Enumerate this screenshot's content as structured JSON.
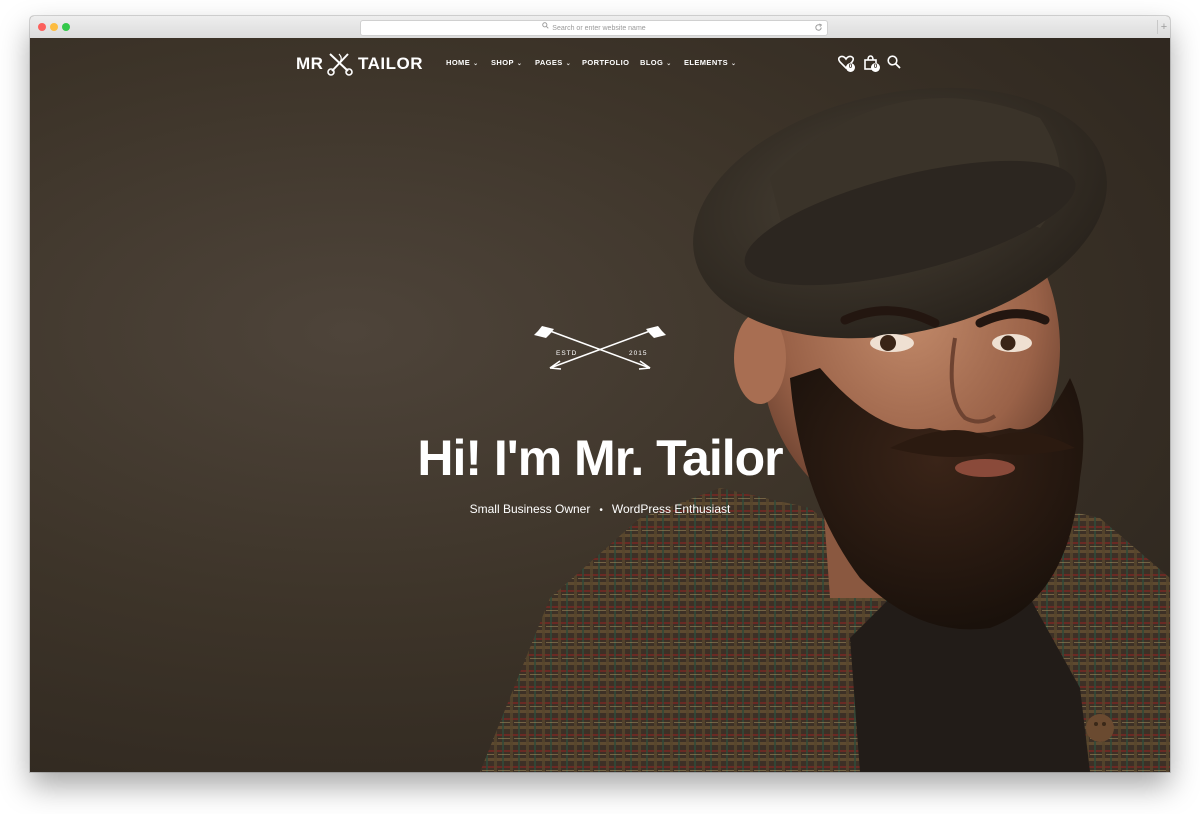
{
  "browser": {
    "url_placeholder": "Search or enter website name",
    "new_tab_symbol": "+"
  },
  "site": {
    "logo_left": "MR",
    "logo_right": "TAILOR"
  },
  "nav": {
    "items": [
      {
        "label": "HOME",
        "has_dropdown": true
      },
      {
        "label": "SHOP",
        "has_dropdown": true
      },
      {
        "label": "PAGES",
        "has_dropdown": true
      },
      {
        "label": "PORTFOLIO",
        "has_dropdown": false
      },
      {
        "label": "BLOG",
        "has_dropdown": true
      },
      {
        "label": "ELEMENTS",
        "has_dropdown": true
      }
    ],
    "dropdown_glyph": "⌄",
    "wishlist_count": "0",
    "cart_count": "0",
    "icons": [
      "heart-icon",
      "shopping-bag-icon",
      "search-icon"
    ]
  },
  "hero": {
    "emblem_left": "ESTD",
    "emblem_right": "2015",
    "headline": "Hi! I'm Mr. Tailor",
    "subline_part1": "Small Business Owner",
    "subline_separator": "•",
    "subline_part2": "WordPress Enthusiast"
  },
  "colors": {
    "background": "#3b3229",
    "text": "#ffffff",
    "chrome": "#e4e4e4"
  }
}
